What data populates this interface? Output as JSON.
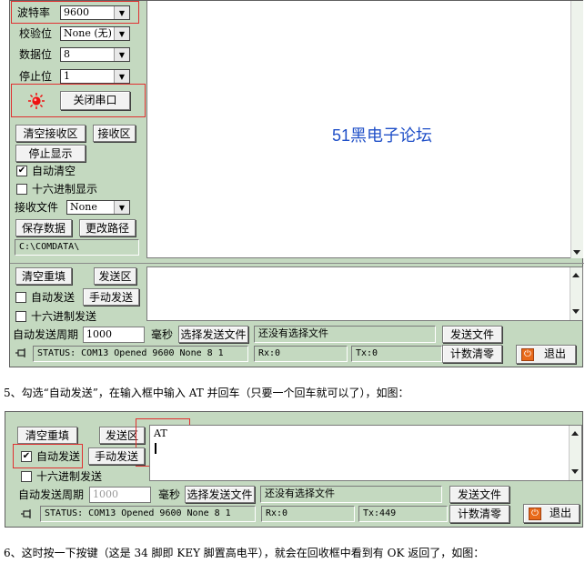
{
  "top": {
    "baud_label": "波特率",
    "baud_value": "9600",
    "parity_label": "校验位",
    "parity_value": "None (无)",
    "databits_label": "数据位",
    "databits_value": "8",
    "stopbits_label": "停止位",
    "stopbits_value": "1",
    "close_port": "关闭串口",
    "clear_receive": "清空接收区",
    "receive_area": "接收区",
    "stop_display": "停止显示",
    "auto_clear": "自动清空",
    "hex_display": "十六进制显示",
    "receive_file_label": "接收文件",
    "receive_file_value": "None",
    "save_data": "保存数据",
    "change_path": "更改路径",
    "path": "C:\\COMDATA\\",
    "watermark_num": "51",
    "watermark_text": "黑电子论坛",
    "clear_resend": "清空重填",
    "send_area": "发送区",
    "auto_send": "自动发送",
    "manual_send": "手动发送",
    "hex_send": "十六进制发送",
    "auto_period_label": "自动发送周期",
    "auto_period_value": "1000",
    "ms": "毫秒",
    "select_file": "选择发送文件",
    "no_file": "还没有选择文件",
    "send_file": "发送文件",
    "status": "STATUS: COM13 Opened 9600 None  8 1",
    "rx": "Rx:0",
    "tx": "Tx:0",
    "count_clear": "计数清零",
    "exit": "退出"
  },
  "caption1": "5、勾选“自动发送”，在输入框中输入 AT 并回车（只要一个回车就可以了），如图：",
  "bottom": {
    "clear_resend": "清空重填",
    "send_area": "发送区",
    "auto_send": "自动发送",
    "manual_send": "手动发送",
    "hex_send": "十六进制发送",
    "input_text": "AT",
    "auto_period_label": "自动发送周期",
    "auto_period_value": "1000",
    "ms": "毫秒",
    "select_file": "选择发送文件",
    "no_file": "还没有选择文件",
    "send_file": "发送文件",
    "status": "STATUS: COM13 Opened 9600 None  8 1",
    "rx": "Rx:0",
    "tx": "Tx:449",
    "count_clear": "计数清零",
    "exit": "退出"
  },
  "caption2": "6、这时按一下按键（这是 34 脚即 KEY 脚置高电平），就会在回收框中看到有 OK 返回了，如图：",
  "colors": {
    "panel": "#c4d9c0",
    "highlight_box": "#e03030",
    "watermark": "#2050c8",
    "led": "#ee1111"
  },
  "icons": [
    "dropdown-arrow-icon",
    "led-icon",
    "checkmark-icon",
    "pin-icon",
    "power-icon",
    "scroll-up-icon",
    "scroll-down-icon"
  ]
}
